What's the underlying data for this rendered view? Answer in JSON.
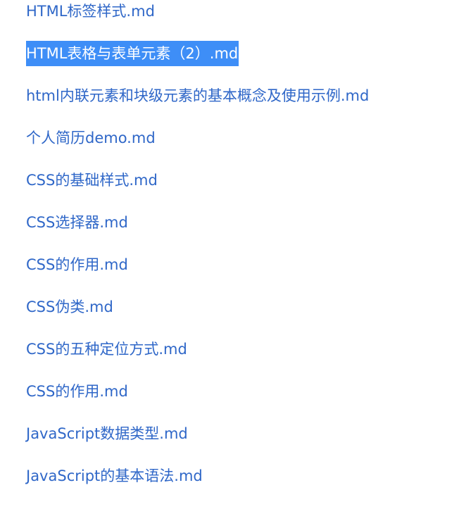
{
  "files": [
    {
      "name": "HTML标签样式.md",
      "selected": false
    },
    {
      "name": "HTML表格与表单元素（2）.md",
      "selected": true
    },
    {
      "name": "html内联元素和块级元素的基本概念及使用示例.md",
      "selected": false
    },
    {
      "name": "个人简历demo.md",
      "selected": false
    },
    {
      "name": "CSS的基础样式.md",
      "selected": false
    },
    {
      "name": "CSS选择器.md",
      "selected": false
    },
    {
      "name": "CSS的作用.md",
      "selected": false
    },
    {
      "name": "CSS伪类.md",
      "selected": false
    },
    {
      "name": "CSS的五种定位方式.md",
      "selected": false
    },
    {
      "name": "CSS的作用.md",
      "selected": false
    },
    {
      "name": "JavaScript数据类型.md",
      "selected": false
    },
    {
      "name": "JavaScript的基本语法.md",
      "selected": false
    }
  ]
}
